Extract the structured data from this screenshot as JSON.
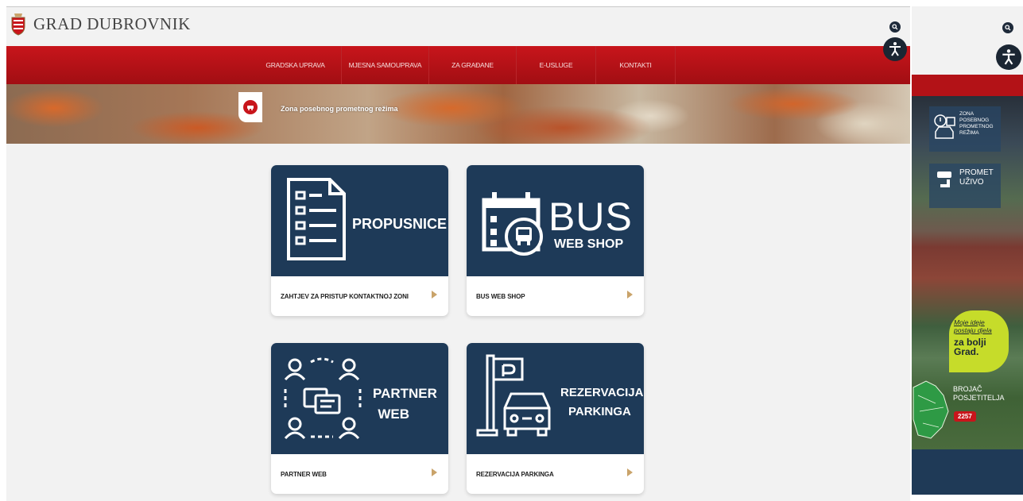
{
  "header": {
    "logo_text": "GRAD DUBROVNIK"
  },
  "nav": {
    "items": [
      {
        "label": "GRADSKA UPRAVA"
      },
      {
        "label": "MJESNA SAMOUPRAVA"
      },
      {
        "label": "ZA GRAĐANE"
      },
      {
        "label": "E-USLUGE"
      },
      {
        "label": "KONTAKTI"
      }
    ]
  },
  "hero": {
    "title": "Zona posebnog prometnog režima"
  },
  "cards": [
    {
      "banner": "PROPUSNICE",
      "label": "ZAHTJEV ZA PRISTUP KONTAKTNOJ ZONI",
      "icon": "document-list-icon"
    },
    {
      "banner_line1": "BUS",
      "banner_line2": "WEB SHOP",
      "label": "BUS WEB SHOP",
      "icon": "calendar-bus-icon"
    },
    {
      "banner_line1": "PARTNER",
      "banner_line2": "WEB",
      "label": "PARTNER WEB",
      "icon": "people-chat-icon"
    },
    {
      "banner_line1": "REZERVACIJA",
      "banner_line2": "PARKINGA",
      "label": "REZERVACIJA PARKINGA",
      "icon": "parking-car-icon"
    }
  ],
  "sidebar": {
    "zona_lines": [
      "ZONA",
      "POSEBNOG",
      "PROMETNOG",
      "REŽIMA"
    ],
    "promet_lines": [
      "PROMET",
      "UŽIVO"
    ],
    "ideja_small": [
      "Moje ideje",
      "postaju djela"
    ],
    "ideja_big": [
      "za bolji",
      "Grad."
    ],
    "brojac_lines": [
      "BROJAČ",
      "POSJETITELJA"
    ],
    "brojac_count": "2257"
  },
  "colors": {
    "brand_red": "#c8151b",
    "card_navy": "#1e3a58",
    "arrow_gold": "#c9a36a",
    "ideja_green": "#c6dc2a"
  }
}
